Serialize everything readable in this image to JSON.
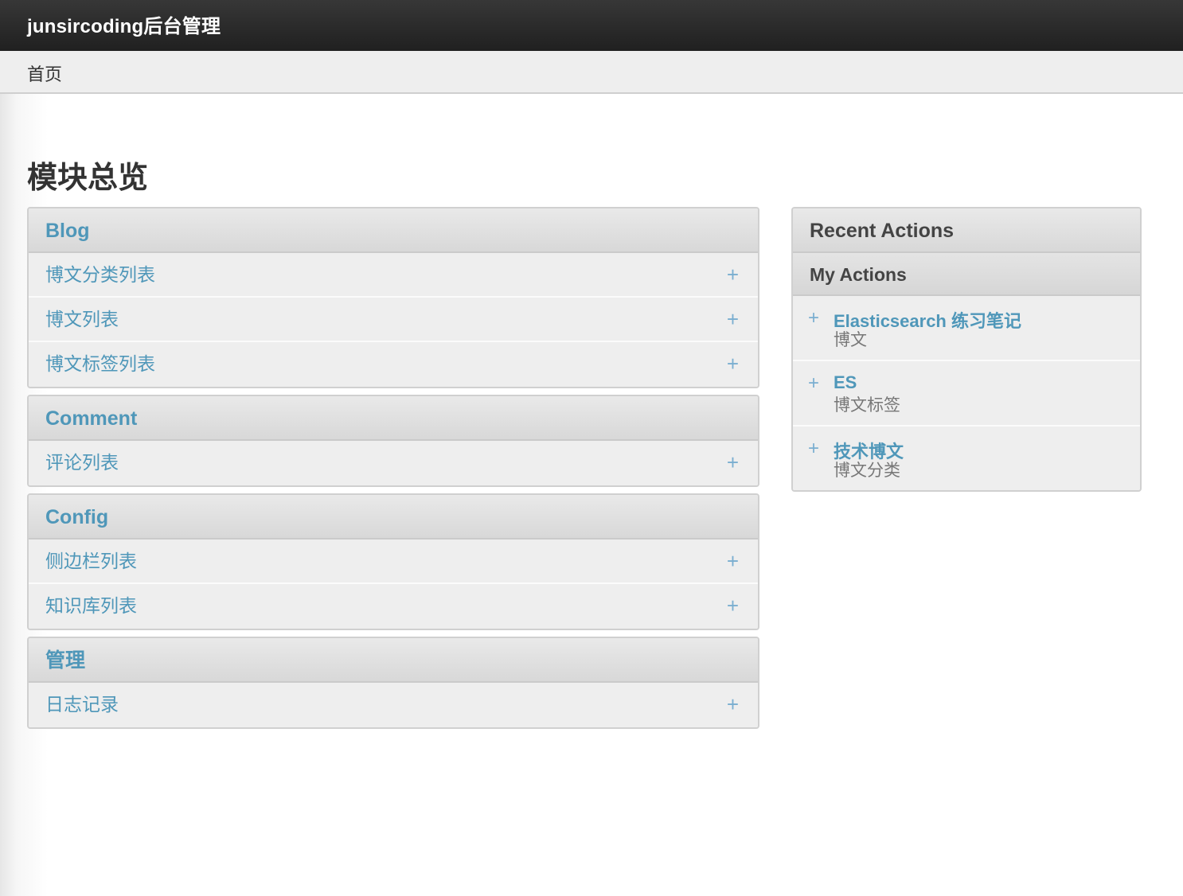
{
  "header": {
    "brand": "junsircoding后台管理"
  },
  "breadcrumbs": {
    "home": "首页"
  },
  "page": {
    "title": "模块总览"
  },
  "modules": [
    {
      "name": "Blog",
      "rows": [
        "博文分类列表",
        "博文列表",
        "博文标签列表"
      ]
    },
    {
      "name": "Comment",
      "rows": [
        "评论列表"
      ]
    },
    {
      "name": "Config",
      "rows": [
        "侧边栏列表",
        "知识库列表"
      ]
    },
    {
      "name": "管理",
      "rows": [
        "日志记录"
      ]
    }
  ],
  "add_symbol": "+",
  "recent": {
    "title": "Recent Actions",
    "subtitle": "My Actions",
    "items": [
      {
        "title": "Elasticsearch 练习笔记",
        "type": "博文"
      },
      {
        "title": "ES",
        "type": "博文标签"
      },
      {
        "title": "技术博文",
        "type": "博文分类"
      }
    ]
  },
  "colors": {
    "header_bg": "#2b2b2b",
    "link": "#4f97b9",
    "add_icon": "#7aaed0",
    "module_bg": "#eeeeee",
    "module_head": "#dcdcdc",
    "text_dark": "#333333"
  }
}
